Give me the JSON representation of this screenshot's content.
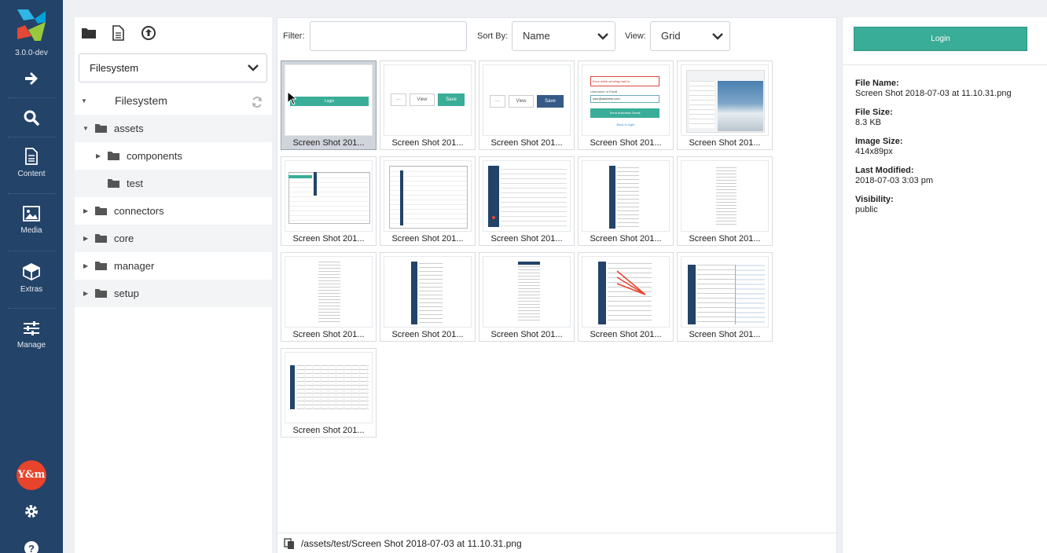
{
  "app": {
    "version": "3.0.0-dev",
    "accent": "#234368",
    "brand_green": "#3aad98"
  },
  "nav": {
    "items": [
      {
        "icon": "arrow-right-icon",
        "label": ""
      },
      {
        "icon": "search-icon",
        "label": ""
      },
      {
        "icon": "content-icon",
        "label": "Content"
      },
      {
        "icon": "media-icon",
        "label": "Media"
      },
      {
        "icon": "extras-icon",
        "label": "Extras"
      },
      {
        "icon": "manage-icon",
        "label": "Manage"
      }
    ],
    "avatar_text": "Y&m"
  },
  "tree": {
    "source_select": "Filesystem",
    "root": "Filesystem",
    "nodes": [
      {
        "label": "assets"
      },
      {
        "label": "components"
      },
      {
        "label": "test"
      },
      {
        "label": "connectors"
      },
      {
        "label": "core"
      },
      {
        "label": "manager"
      },
      {
        "label": "setup"
      }
    ]
  },
  "toolbar": {
    "filter_label": "Filter:",
    "filter_value": "",
    "sort_label": "Sort By:",
    "sort_value": "Name",
    "view_label": "View:",
    "view_value": "Grid"
  },
  "files": [
    {
      "caption": "Screen Shot 201..."
    },
    {
      "caption": "Screen Shot 201..."
    },
    {
      "caption": "Screen Shot 201..."
    },
    {
      "caption": "Screen Shot 201..."
    },
    {
      "caption": "Screen Shot 201..."
    },
    {
      "caption": "Screen Shot 201..."
    },
    {
      "caption": "Screen Shot 201..."
    },
    {
      "caption": "Screen Shot 201..."
    },
    {
      "caption": "Screen Shot 201..."
    },
    {
      "caption": "Screen Shot 201..."
    },
    {
      "caption": "Screen Shot 201..."
    },
    {
      "caption": "Screen Shot 201..."
    },
    {
      "caption": "Screen Shot 201..."
    },
    {
      "caption": "Screen Shot 201..."
    },
    {
      "caption": "Screen Shot 201..."
    },
    {
      "caption": "Screen Shot 201..."
    }
  ],
  "thumb_text": {
    "login": "Login",
    "view": "View",
    "save": "Save",
    "dots": "···",
    "error": "Error while sending mail to",
    "username_label": "Username or Email",
    "username_value": "user@address.com",
    "send_button": "Send Activation Email",
    "back": "Back to login"
  },
  "status": {
    "path": "/assets/test/Screen Shot 2018-07-03 at 11.10.31.png"
  },
  "preview": {
    "button_label": "Login",
    "meta": [
      {
        "label": "File Name:",
        "value": "Screen Shot 2018-07-03 at 11.10.31.png"
      },
      {
        "label": "File Size:",
        "value": "8.3 KB"
      },
      {
        "label": "Image Size:",
        "value": "414x89px"
      },
      {
        "label": "Last Modified:",
        "value": "2018-07-03 3:03 pm"
      },
      {
        "label": "Visibility:",
        "value": "public"
      }
    ]
  }
}
